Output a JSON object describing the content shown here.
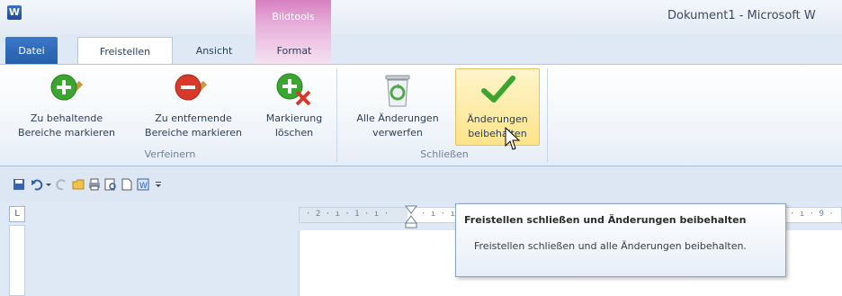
{
  "window": {
    "app_icon_letter": "W",
    "title": "Dokument1 - Microsoft W"
  },
  "context_group": {
    "label": "Bildtools",
    "color": "#e7b0da"
  },
  "tabs": [
    {
      "label": "Datei",
      "active": false
    },
    {
      "label": "Freistellen",
      "active": true
    },
    {
      "label": "Ansicht",
      "active": false
    },
    {
      "label": "Format",
      "active": false
    }
  ],
  "ribbon": {
    "groups": [
      {
        "label": "Verfeinern",
        "buttons": [
          {
            "line1": "Zu behaltende",
            "line2": "Bereiche markieren",
            "icon": "plus-pen-icon",
            "color": "#3aa52f"
          },
          {
            "line1": "Zu entfernende",
            "line2": "Bereiche markieren",
            "icon": "minus-pen-icon",
            "color": "#d83a2a"
          },
          {
            "line1": "Markierung",
            "line2": "löschen",
            "icon": "delete-mark-icon",
            "color": "#3aa52f"
          }
        ]
      },
      {
        "label": "Schließen",
        "buttons": [
          {
            "line1": "Alle Änderungen",
            "line2": "verwerfen",
            "icon": "recycle-bin-icon",
            "color": "#4fa84a"
          },
          {
            "line1": "Änderungen",
            "line2": "beibehalten",
            "icon": "checkmark-icon",
            "color": "#3aa52f",
            "highlighted": true
          }
        ]
      }
    ]
  },
  "qat": {
    "icons": [
      "save-icon",
      "undo-icon",
      "undo-dropdown-icon",
      "redo-icon",
      "open-icon",
      "print-icon",
      "print-preview-icon",
      "new-document-icon",
      "word-art-icon",
      "customize-qat-icon"
    ]
  },
  "ruler": {
    "corner": "L",
    "left_text": "· 2 · ı · 1 · ı ·",
    "mid_text": "· ı · ı",
    "right_text": "· ı · 9 ·"
  },
  "tooltip": {
    "title": "Freistellen schließen und Änderungen beibehalten",
    "body": "Freistellen schließen und alle Änderungen beibehalten."
  }
}
